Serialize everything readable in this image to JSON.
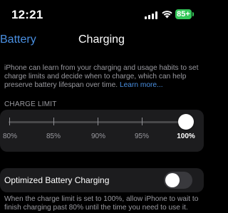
{
  "status_bar": {
    "time": "12:21",
    "battery": "85+"
  },
  "nav": {
    "back": "Battery",
    "title": "Charging"
  },
  "description": {
    "text": "iPhone can learn from your charging and usage habits to set charge limits and decide when to charge, which can help preserve battery lifespan over time. ",
    "link": "Learn more..."
  },
  "charge_limit": {
    "label": "CHARGE LIMIT",
    "ticks": [
      "80%",
      "85%",
      "90%",
      "95%",
      "100%"
    ],
    "selected_index": 4,
    "selected": "100%"
  },
  "optimized": {
    "label": "Optimized Battery Charging",
    "enabled": false
  },
  "footer": {
    "text": "When the charge limit is set to 100%, allow iPhone to wait to finish charging past 80% until the time you need to use it."
  },
  "colors": {
    "accent": "#4a90e2",
    "battery": "#34c759"
  }
}
